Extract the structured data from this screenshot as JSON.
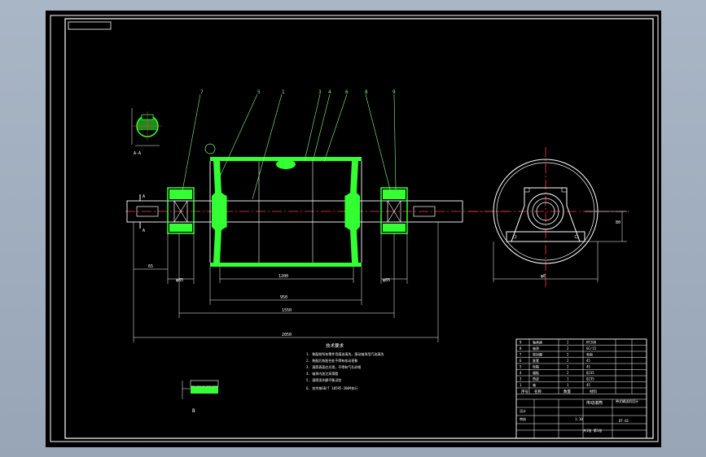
{
  "viewport": {
    "background": "#a0adbf",
    "paper": "#000000"
  },
  "colors": {
    "outline": "#ffffff",
    "part": "#33ff33",
    "center_line": "#ff3b3b",
    "dimension": "#ffffff"
  },
  "drawing": {
    "balloons": [
      "7",
      "5",
      "1",
      "3",
      "4",
      "6",
      "8",
      "9"
    ],
    "section_marks": [
      "A",
      "A",
      "B"
    ],
    "section_label": "A-A",
    "detail_label": "B",
    "dims": {
      "d_left_shaft": "65",
      "d_left_bearing": "φ85",
      "d_right_bearing": "φ85",
      "face_width": "1200",
      "drum_length": "950",
      "bearing_span": "1550",
      "overall_length": "2050",
      "height_center": "80",
      "base_width": "φ8",
      "base_height": "80"
    },
    "notes_title": "技术要求",
    "notes": [
      "1. 装配前所有零件用煤油清洗，滚动轴承用汽油清洗",
      "2. 装配后各配合处不得有松动现象",
      "3. 滚筒表面应光滑，不得有气孔砂眼",
      "4. 轴承内加注润滑脂",
      "5. 滚筒须作静平衡试验",
      "6. 其余按GB/T 10595-2009执行"
    ]
  },
  "title_block": {
    "parts_rows": [
      {
        "no": "9",
        "name": "轴承座",
        "qty": "2",
        "mat": "HT200"
      },
      {
        "no": "8",
        "name": "轴承",
        "qty": "2",
        "mat": "GCr15"
      },
      {
        "no": "7",
        "name": "密封圈",
        "qty": "2",
        "mat": "毛毡"
      },
      {
        "no": "6",
        "name": "胀套",
        "qty": "2",
        "mat": "45"
      },
      {
        "no": "5",
        "name": "轮毂",
        "qty": "2",
        "mat": "45"
      },
      {
        "no": "4",
        "name": "辐板",
        "qty": "2",
        "mat": "Q235"
      },
      {
        "no": "3",
        "name": "筒皮",
        "qty": "1",
        "mat": "Q235"
      },
      {
        "no": "1",
        "name": "轴",
        "qty": "1",
        "mat": "45"
      }
    ],
    "header": {
      "no": "序号",
      "name": "名称",
      "qty": "数量",
      "mat": "材料"
    },
    "drawing_title": "传动滚筒",
    "company": "带式输送机设计",
    "scale": "1:10",
    "sheet": "共1张 第1张",
    "designer": "设计",
    "checker": "审核",
    "drawing_no": "DT-01"
  }
}
